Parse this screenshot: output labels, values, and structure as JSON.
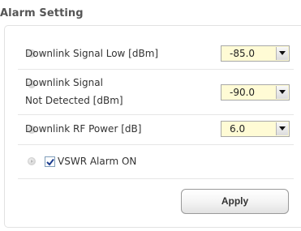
{
  "section": {
    "title": "Alarm Setting"
  },
  "settings": {
    "downlink_signal_low": {
      "label": "Downlink Signal Low [dBm]",
      "value": "-85.0"
    },
    "downlink_signal_not_detected": {
      "label_line1": "Downlink Signal",
      "label_line2": "Not Detected [dBm]",
      "value": "-90.0"
    },
    "downlink_rf_power": {
      "label": "Downlink RF Power [dB]",
      "value": "6.0"
    },
    "vswr_alarm": {
      "label": "VSWR Alarm ON",
      "checked": true
    }
  },
  "actions": {
    "apply_label": "Apply"
  },
  "colors": {
    "select_background": "#fffbd5",
    "title_text": "#555555",
    "checkmark": "#1c3d8f"
  },
  "icons": {
    "row_bullet": "arrow-bullet-icon",
    "dropdown": "chevron-down-icon",
    "checkbox": "checkmark-icon"
  }
}
